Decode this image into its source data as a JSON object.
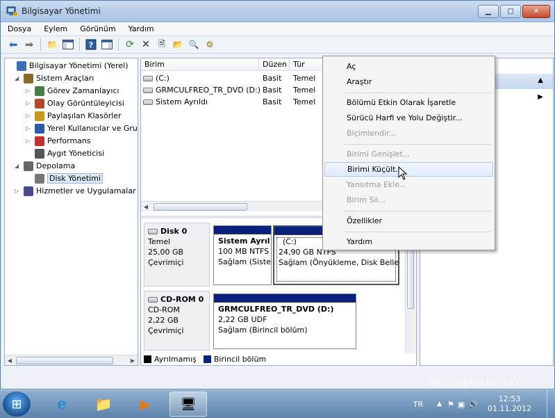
{
  "window": {
    "title": "Bilgisayar Yönetimi",
    "buttons": {
      "minimize": "▁",
      "maximize": "□",
      "close": "✕"
    }
  },
  "menubar": [
    "Dosya",
    "Eylem",
    "Görünüm",
    "Yardım"
  ],
  "toolbar_icons": [
    "back-arrow-icon",
    "forward-arrow-icon",
    "folder-up-icon",
    "console-tree-icon",
    "help-icon",
    "show-pane-icon",
    "refresh-icon",
    "delete-icon",
    "properties-icon",
    "open-folder-icon",
    "search-icon",
    "rescan-icon"
  ],
  "tree": [
    {
      "label": "Bilgisayar Yönetimi (Yerel)",
      "level": 0,
      "expander": "",
      "icon": "computer-management-icon"
    },
    {
      "label": "Sistem Araçları",
      "level": 1,
      "expander": "◢",
      "icon": "tools-icon"
    },
    {
      "label": "Görev Zamanlayıcı",
      "level": 2,
      "expander": "▷",
      "icon": "clock-icon"
    },
    {
      "label": "Olay Görüntüleyicisi",
      "level": 2,
      "expander": "▷",
      "icon": "event-viewer-icon"
    },
    {
      "label": "Paylaşılan Klasörler",
      "level": 2,
      "expander": "▷",
      "icon": "shared-folder-icon"
    },
    {
      "label": "Yerel Kullanıcılar ve Gru",
      "level": 2,
      "expander": "▷",
      "icon": "users-icon"
    },
    {
      "label": "Performans",
      "level": 2,
      "expander": "▷",
      "icon": "performance-icon"
    },
    {
      "label": "Aygıt Yöneticisi",
      "level": 2,
      "expander": "",
      "icon": "device-manager-icon"
    },
    {
      "label": "Depolama",
      "level": 1,
      "expander": "◢",
      "icon": "storage-icon"
    },
    {
      "label": "Disk Yönetimi",
      "level": 2,
      "expander": "",
      "icon": "disk-management-icon",
      "selected": true
    },
    {
      "label": "Hizmetler ve Uygulamalar",
      "level": 1,
      "expander": "▷",
      "icon": "services-icon"
    }
  ],
  "volume_table": {
    "columns": [
      "Birim",
      "Düzen",
      "Tür"
    ],
    "rows": [
      {
        "name": "(C:)",
        "layout": "Basit",
        "type": "Temel"
      },
      {
        "name": "GRMCULFREO_TR_DVD (D:)",
        "layout": "Basit",
        "type": "Temel"
      },
      {
        "name": "Sistem Ayrıldı",
        "layout": "Basit",
        "type": "Temel"
      }
    ]
  },
  "disks": [
    {
      "name": "Disk 0",
      "kind": "Temel",
      "size": "25,00 GB",
      "status": "Çevrimiçi",
      "partitions": [
        {
          "name": "Sistem Ayrıl",
          "size": "100 MB NTFS",
          "health": "Sağlam (Siste"
        },
        {
          "name": "(C:)",
          "size": "24,90 GB NTFS",
          "health": "Sağlam (Önyükleme, Disk Belleğ"
        }
      ]
    },
    {
      "name": "CD-ROM 0",
      "kind": "CD-ROM",
      "size": "2,22 GB",
      "status": "Çevrimiçi",
      "partitions": [
        {
          "name": "GRMCULFREO_TR_DVD  (D:)",
          "size": "2,22 GB UDF",
          "health": "Sağlam (Birincil bölüm)"
        }
      ]
    }
  ],
  "legend": [
    {
      "label": "Ayrılmamış",
      "color": "#000000"
    },
    {
      "label": "Birincil bölüm",
      "color": "#0a2080"
    }
  ],
  "context_menu": [
    {
      "label": "Aç",
      "enabled": true
    },
    {
      "label": "Araştır",
      "enabled": true
    },
    {
      "label": "Bölümü Etkin Olarak İşaretle",
      "enabled": true
    },
    {
      "label": "Sürücü Harfi ve Yolu Değiştir...",
      "enabled": true
    },
    {
      "label": "Biçimlendir...",
      "enabled": false
    },
    {
      "label": "Birimi Genişlet...",
      "enabled": false
    },
    {
      "label": "Birimi Küçült...",
      "enabled": true,
      "hover": true
    },
    {
      "label": "Yansıtma Ekle...",
      "enabled": false
    },
    {
      "label": "Birim Sil...",
      "enabled": false
    },
    {
      "label": "Özellikler",
      "enabled": true
    },
    {
      "label": "Yardım",
      "enabled": true
    }
  ],
  "taskbar": {
    "apps": [
      "internet-explorer-icon",
      "explorer-icon",
      "media-player-icon",
      "computer-management-icon"
    ],
    "language": "TR",
    "time": "12:53",
    "date": "01.11.2012"
  },
  "watermark": "twis_eyisekerciler"
}
